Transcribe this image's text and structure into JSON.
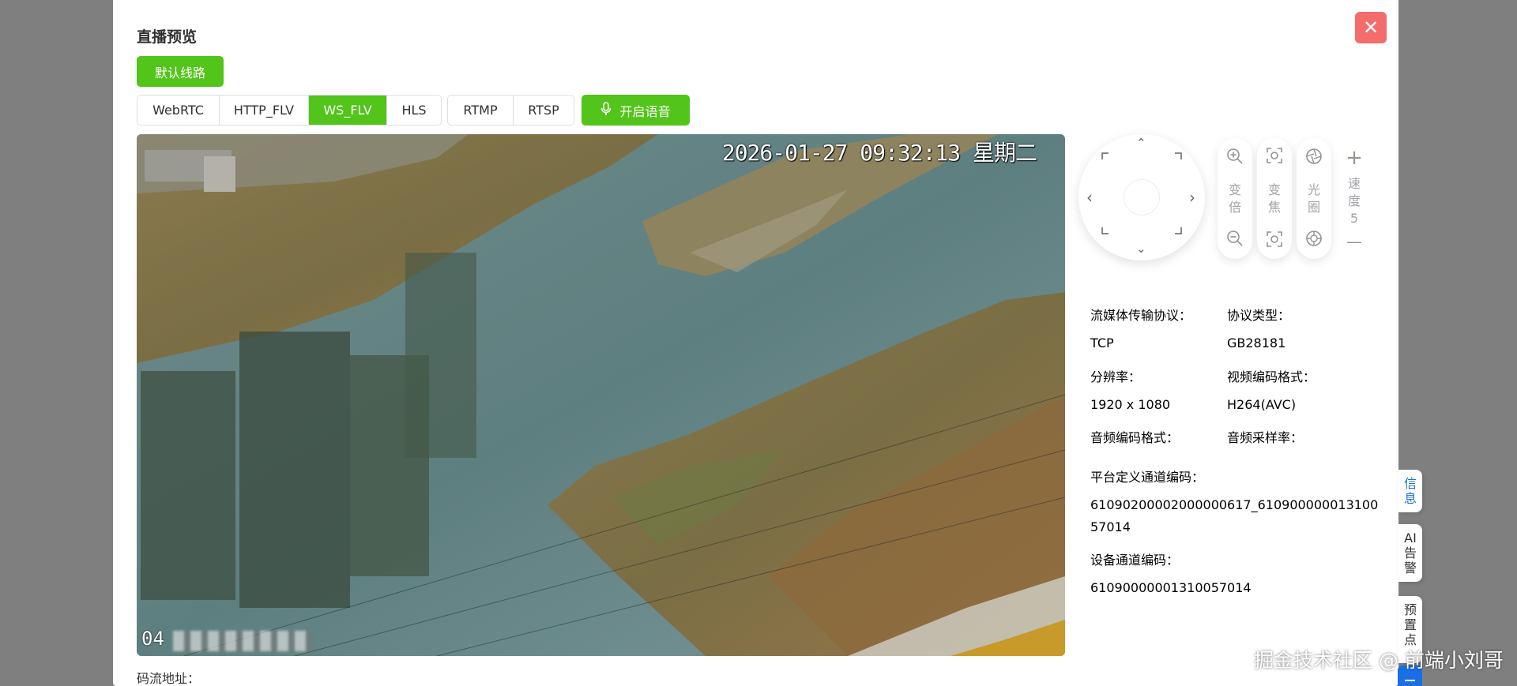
{
  "dialog": {
    "title": "直播预览",
    "close_glyph": "✕",
    "route_label": "默认线路"
  },
  "protocols": {
    "group1": [
      "WebRTC",
      "HTTP_FLV",
      "WS_FLV",
      "HLS"
    ],
    "group2": [
      "RTMP",
      "RTSP"
    ],
    "active": "WS_FLV"
  },
  "voice": {
    "label": "开启语音",
    "icon": "microphone-icon"
  },
  "video": {
    "timestamp": "2026-01-27 09:32:13 星期二",
    "label_visible": "04"
  },
  "stream_url_label": "码流地址：",
  "ptz": {
    "arrows": {
      "up": "⌃",
      "down": "⌄",
      "left": "‹",
      "right": "›"
    },
    "zoom": {
      "label": "变倍",
      "plus_icon": "zoom-in-icon",
      "minus_icon": "zoom-out-icon"
    },
    "focus": {
      "label": "变焦",
      "plus_icon": "focus-near-icon",
      "minus_icon": "focus-far-icon"
    },
    "iris": {
      "label": "光圈",
      "plus_icon": "aperture-open-icon",
      "minus_icon": "aperture-close-icon"
    },
    "speed": {
      "label": "速度",
      "value": "5",
      "plus": "+",
      "minus": "—"
    }
  },
  "info": {
    "transport_label": "流媒体传输协议：",
    "transport_value": "TCP",
    "protocol_label": "协议类型：",
    "protocol_value": "GB28181",
    "resolution_label": "分辨率：",
    "resolution_value": "1920 x 1080",
    "video_codec_label": "视频编码格式：",
    "video_codec_value": "H264(AVC)",
    "audio_codec_label": "音频编码格式：",
    "audio_rate_label": "音频采样率：",
    "platform_channel_label": "平台定义通道编码：",
    "platform_channel_value_line1": "61090200002000000617_610900000013100",
    "platform_channel_value_line2": "57014",
    "device_channel_label": "设备通道编码：",
    "device_channel_value": "61090000001310057014"
  },
  "side_tabs": [
    {
      "label": "信息",
      "active": true
    },
    {
      "label": "AI告警",
      "active": false
    },
    {
      "label": "预置点",
      "active": false
    }
  ],
  "watermark": "掘金技术社区 @ 前端小刘哥",
  "colors": {
    "primary": "#52c41a",
    "danger": "#f56c6c",
    "accent": "#1a6fe6"
  }
}
